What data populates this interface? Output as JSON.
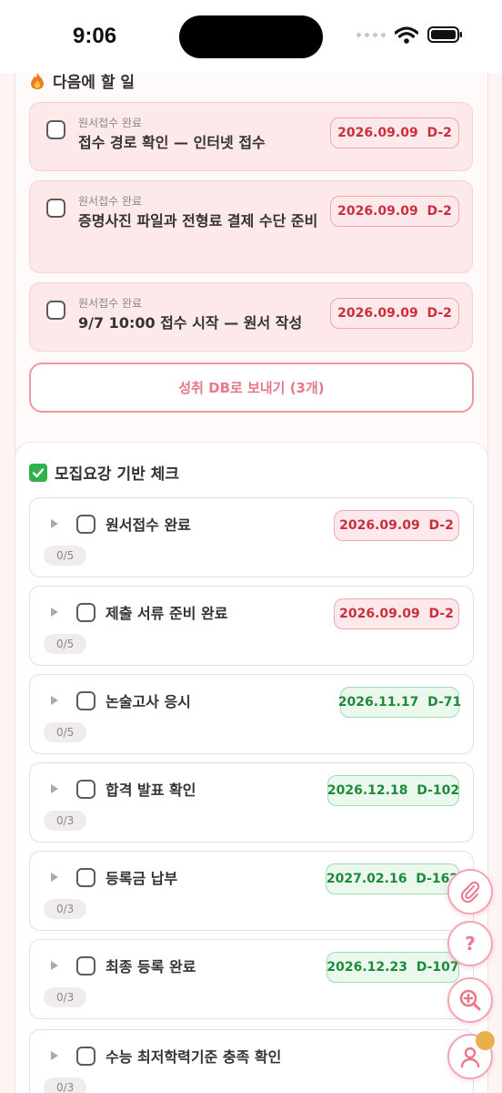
{
  "status_bar": {
    "time": "9:06"
  },
  "next_section": {
    "title": "다음에 할 일",
    "items": [
      {
        "category": "원서접수 완료",
        "text": "접수 경로 확인 — 인터넷 접수",
        "date": "2026.09.09  D-2"
      },
      {
        "category": "원서접수 완료",
        "text": "증명사진 파일과 전형료 결제 수단 준비",
        "date": "2026.09.09  D-2"
      },
      {
        "category": "원서접수 완료",
        "text": "9/7 10:00 접수 시작 — 원서 작성",
        "date": "2026.09.09  D-2"
      }
    ],
    "send_button": "성취 DB로 보내기 (3개)"
  },
  "check_section": {
    "title": "모집요강 기반 체크",
    "milestones": [
      {
        "label": "원서접수 완료",
        "date": "2026.09.09  D-2",
        "status": "urgent",
        "progress": "0/5"
      },
      {
        "label": "제출 서류 준비 완료",
        "date": "2026.09.09  D-2",
        "status": "urgent",
        "progress": "0/5"
      },
      {
        "label": "논술고사 응시",
        "date": "2026.11.17  D-71",
        "status": "upcoming",
        "progress": "0/5"
      },
      {
        "label": "합격 발표 확인",
        "date": "2026.12.18  D-102",
        "status": "upcoming",
        "progress": "0/3"
      },
      {
        "label": "등록금 납부",
        "date": "2027.02.16  D-162",
        "status": "upcoming",
        "progress": "0/3"
      },
      {
        "label": "최종 등록 완료",
        "date": "2026.12.23  D-107",
        "status": "upcoming",
        "progress": "0/3"
      },
      {
        "label": "수능 최저학력기준 충족 확인",
        "date": "",
        "status": "none",
        "progress": "0/3"
      }
    ]
  },
  "fabs": [
    {
      "icon": "paperclip-icon"
    },
    {
      "icon": "help-icon",
      "label": "?"
    },
    {
      "icon": "zoom-in-icon"
    },
    {
      "icon": "profile-icon"
    }
  ],
  "colors": {
    "accent": "#ef97a5",
    "urgent": "#c9303c",
    "upcoming": "#1f8a3a"
  }
}
